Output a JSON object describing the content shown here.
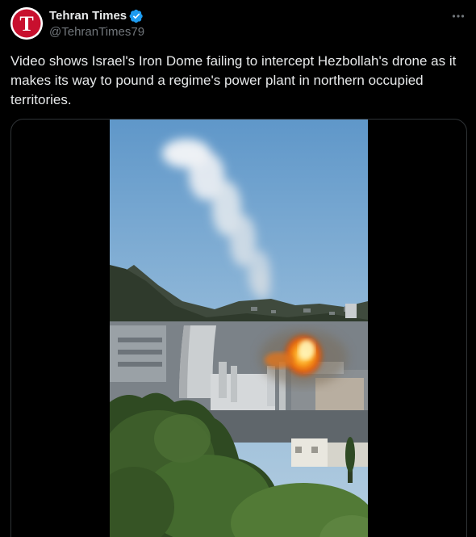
{
  "account": {
    "display_name": "Tehran Times",
    "handle": "@TehranTimes79",
    "avatar_letter": "T",
    "verified": true
  },
  "tweet": {
    "text": "Video shows Israel's Iron Dome failing to intercept Hezbollah's drone as it makes its way to pound a regime's power plant in northern occupied territories."
  },
  "media": {
    "type": "video"
  },
  "icons": {
    "more": "more-horizontal-icon",
    "verified": "verified-badge-icon"
  },
  "colors": {
    "background": "#000000",
    "text": "#e7e9ea",
    "muted": "#71767b",
    "verified": "#1d9bf0",
    "avatar_red": "#c8102e",
    "border": "#2f3336"
  }
}
